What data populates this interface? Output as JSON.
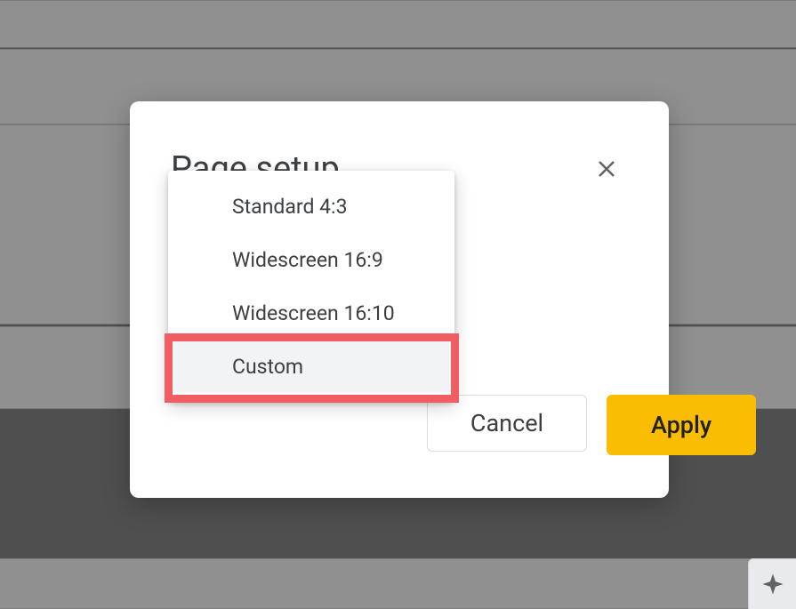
{
  "dialog": {
    "title": "Page setup",
    "options": [
      {
        "label": "Standard 4:3"
      },
      {
        "label": "Widescreen 16:9"
      },
      {
        "label": "Widescreen 16:10"
      },
      {
        "label": "Custom"
      }
    ],
    "cancel_label": "Cancel",
    "apply_label": "Apply"
  }
}
